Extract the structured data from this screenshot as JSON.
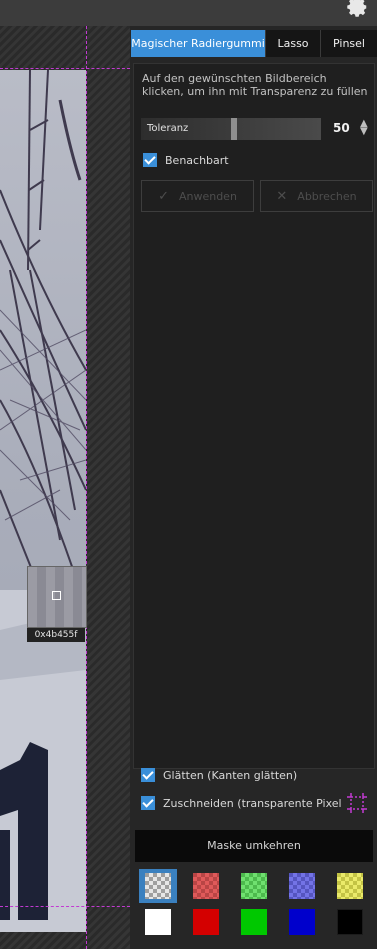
{
  "tabs": [
    {
      "label": "Magischer Radiergummi",
      "active": true
    },
    {
      "label": "Lasso",
      "active": false
    },
    {
      "label": "Pinsel",
      "active": false
    }
  ],
  "tool": {
    "description": "Auf den gewünschten Bildbereich klicken, um ihn mit Transparenz zu füllen",
    "tolerance_label": "Toleranz",
    "tolerance_value": "50",
    "adjacent_label": "Benachbart",
    "adjacent_checked": true,
    "apply_label": "Anwenden",
    "cancel_label": "Abbrechen"
  },
  "options": {
    "smooth_label": "Glätten (Kanten glätten)",
    "smooth_checked": true,
    "crop_label": "Zuschneiden (transparente Pixel",
    "crop_checked": true
  },
  "invert_mask_label": "Maske umkehren",
  "canvas": {
    "color_code": "0x4b455f"
  },
  "swatches": [
    {
      "name": "transparent",
      "color": "checker-gray",
      "selected": true
    },
    {
      "name": "transparent-red",
      "color": "#e05a5a",
      "selected": false
    },
    {
      "name": "transparent-green",
      "color": "#5ae05a",
      "selected": false
    },
    {
      "name": "transparent-blue",
      "color": "#5a5ae0",
      "selected": false
    },
    {
      "name": "transparent-yellow",
      "color": "#e0e05a",
      "selected": false
    },
    {
      "name": "white",
      "color": "#ffffff",
      "selected": false
    },
    {
      "name": "red",
      "color": "#d40000",
      "selected": false
    },
    {
      "name": "green",
      "color": "#00c800",
      "selected": false
    },
    {
      "name": "blue",
      "color": "#0000cc",
      "selected": false
    },
    {
      "name": "black",
      "color": "#000000",
      "selected": false
    }
  ],
  "colors": {
    "accent": "#3a8fd9",
    "guide": "#c23ad2"
  }
}
